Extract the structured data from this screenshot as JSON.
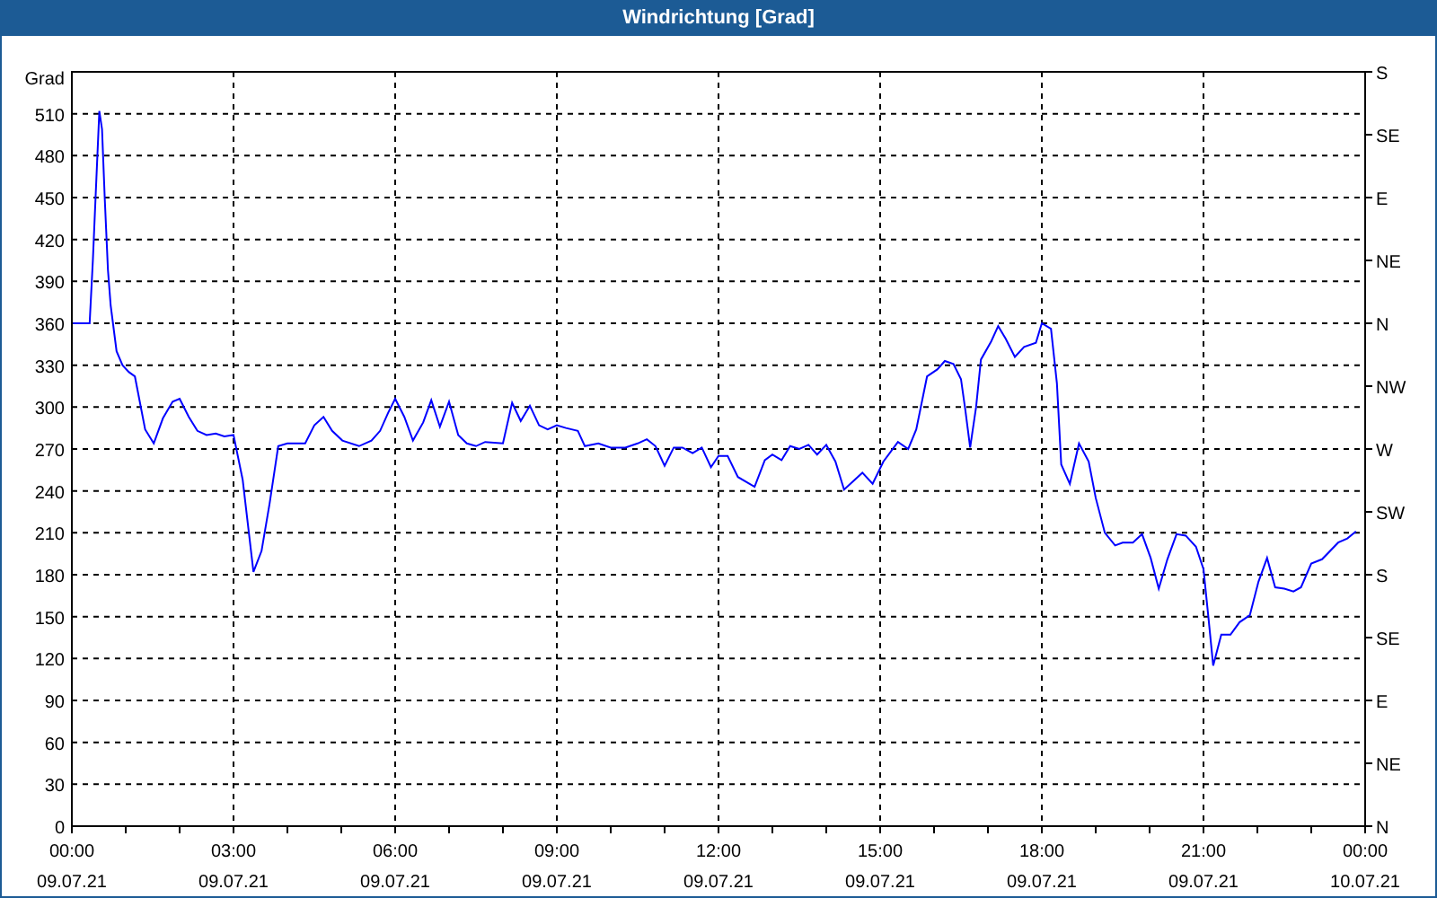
{
  "window": {
    "title": "Windrichtung [Grad]"
  },
  "chart_data": {
    "type": "line",
    "ylabel": "Grad",
    "x": [
      0.02,
      0.33,
      0.39,
      0.44,
      0.51,
      0.56,
      0.61,
      0.67,
      0.72,
      0.83,
      0.94,
      1.06,
      1.17,
      1.36,
      1.52,
      1.69,
      1.87,
      2.0,
      2.17,
      2.33,
      2.5,
      2.67,
      2.83,
      3.0,
      3.17,
      3.37,
      3.52,
      3.67,
      3.83,
      4.0,
      4.33,
      4.5,
      4.67,
      4.83,
      5.02,
      5.33,
      5.56,
      5.72,
      5.87,
      6.0,
      6.17,
      6.33,
      6.52,
      6.67,
      6.83,
      7.0,
      7.17,
      7.33,
      7.5,
      7.67,
      8.0,
      8.17,
      8.33,
      8.5,
      8.67,
      8.83,
      9.0,
      9.17,
      9.39,
      9.52,
      9.77,
      10.0,
      10.27,
      10.5,
      10.67,
      10.83,
      11.0,
      11.17,
      11.33,
      11.52,
      11.69,
      11.86,
      12.0,
      12.17,
      12.36,
      12.67,
      12.86,
      13.0,
      13.17,
      13.33,
      13.5,
      13.67,
      13.83,
      14.0,
      14.17,
      14.33,
      14.67,
      14.86,
      15.06,
      15.33,
      15.52,
      15.67,
      15.87,
      16.06,
      16.2,
      16.36,
      16.5,
      16.58,
      16.67,
      16.78,
      16.87,
      17.06,
      17.19,
      17.33,
      17.5,
      17.67,
      17.89,
      18.0,
      18.17,
      18.28,
      18.36,
      18.52,
      18.69,
      18.87,
      19.0,
      19.17,
      19.36,
      19.5,
      19.69,
      19.86,
      20.02,
      20.17,
      20.33,
      20.5,
      20.67,
      20.86,
      21.0,
      21.09,
      21.18,
      21.33,
      21.5,
      21.67,
      21.86,
      22.02,
      22.18,
      22.33,
      22.5,
      22.67,
      22.81,
      23.0,
      23.2,
      23.5,
      23.67,
      23.83
    ],
    "series": [
      {
        "color": "#0000ff",
        "values": [
          360,
          360,
          405,
          450,
          512,
          499,
          450,
          398,
          373,
          340,
          330,
          325,
          322,
          284,
          274,
          292,
          304,
          306,
          293,
          283,
          280,
          281,
          279,
          280,
          248,
          182,
          197,
          231,
          272,
          274,
          274,
          287,
          293,
          283,
          276,
          272,
          276,
          283,
          296,
          306,
          293,
          276,
          289,
          305,
          286,
          304,
          280,
          274,
          272,
          275,
          274,
          303,
          290,
          301,
          287,
          284,
          287,
          285,
          283,
          272,
          274,
          271,
          271,
          274,
          277,
          272,
          258,
          271,
          271,
          267,
          271,
          257,
          265,
          265,
          250,
          243,
          262,
          266,
          262,
          272,
          270,
          273,
          266,
          273,
          261,
          241,
          253,
          245,
          261,
          275,
          270,
          284,
          322,
          327,
          333,
          331,
          320,
          298,
          271,
          300,
          334,
          347,
          358,
          349,
          336,
          343,
          346,
          360,
          356,
          317,
          259,
          245,
          274,
          261,
          235,
          210,
          201,
          203,
          203,
          209,
          192,
          170,
          191,
          209,
          208,
          200,
          184,
          150,
          115,
          137,
          137,
          146,
          151,
          175,
          192,
          171,
          170,
          168,
          171,
          188,
          191,
          203,
          206,
          211
        ]
      }
    ],
    "xlim": [
      0,
      24
    ],
    "ylim": [
      0,
      540
    ],
    "xticks": [
      {
        "value": 0,
        "label": "00:00"
      },
      {
        "value": 3,
        "label": "03:00"
      },
      {
        "value": 6,
        "label": "06:00"
      },
      {
        "value": 9,
        "label": "09:00"
      },
      {
        "value": 12,
        "label": "12:00"
      },
      {
        "value": 15,
        "label": "15:00"
      },
      {
        "value": 18,
        "label": "18:00"
      },
      {
        "value": 21,
        "label": "21:00"
      },
      {
        "value": 24,
        "label": "00:00"
      }
    ],
    "yticks": [
      0,
      30,
      60,
      90,
      120,
      150,
      180,
      210,
      240,
      270,
      300,
      330,
      360,
      390,
      420,
      450,
      480,
      510
    ],
    "grid": true
  },
  "x_axis_dates": [
    "09.07.21",
    "09.07.21",
    "09.07.21",
    "09.07.21",
    "09.07.21",
    "09.07.21",
    "09.07.21",
    "09.07.21",
    "10.07.21"
  ],
  "compass_axis": [
    "S",
    "SE",
    "E",
    "NE",
    "N",
    "NW",
    "W",
    "SW",
    "S",
    "SE",
    "E",
    "NE",
    "N"
  ]
}
